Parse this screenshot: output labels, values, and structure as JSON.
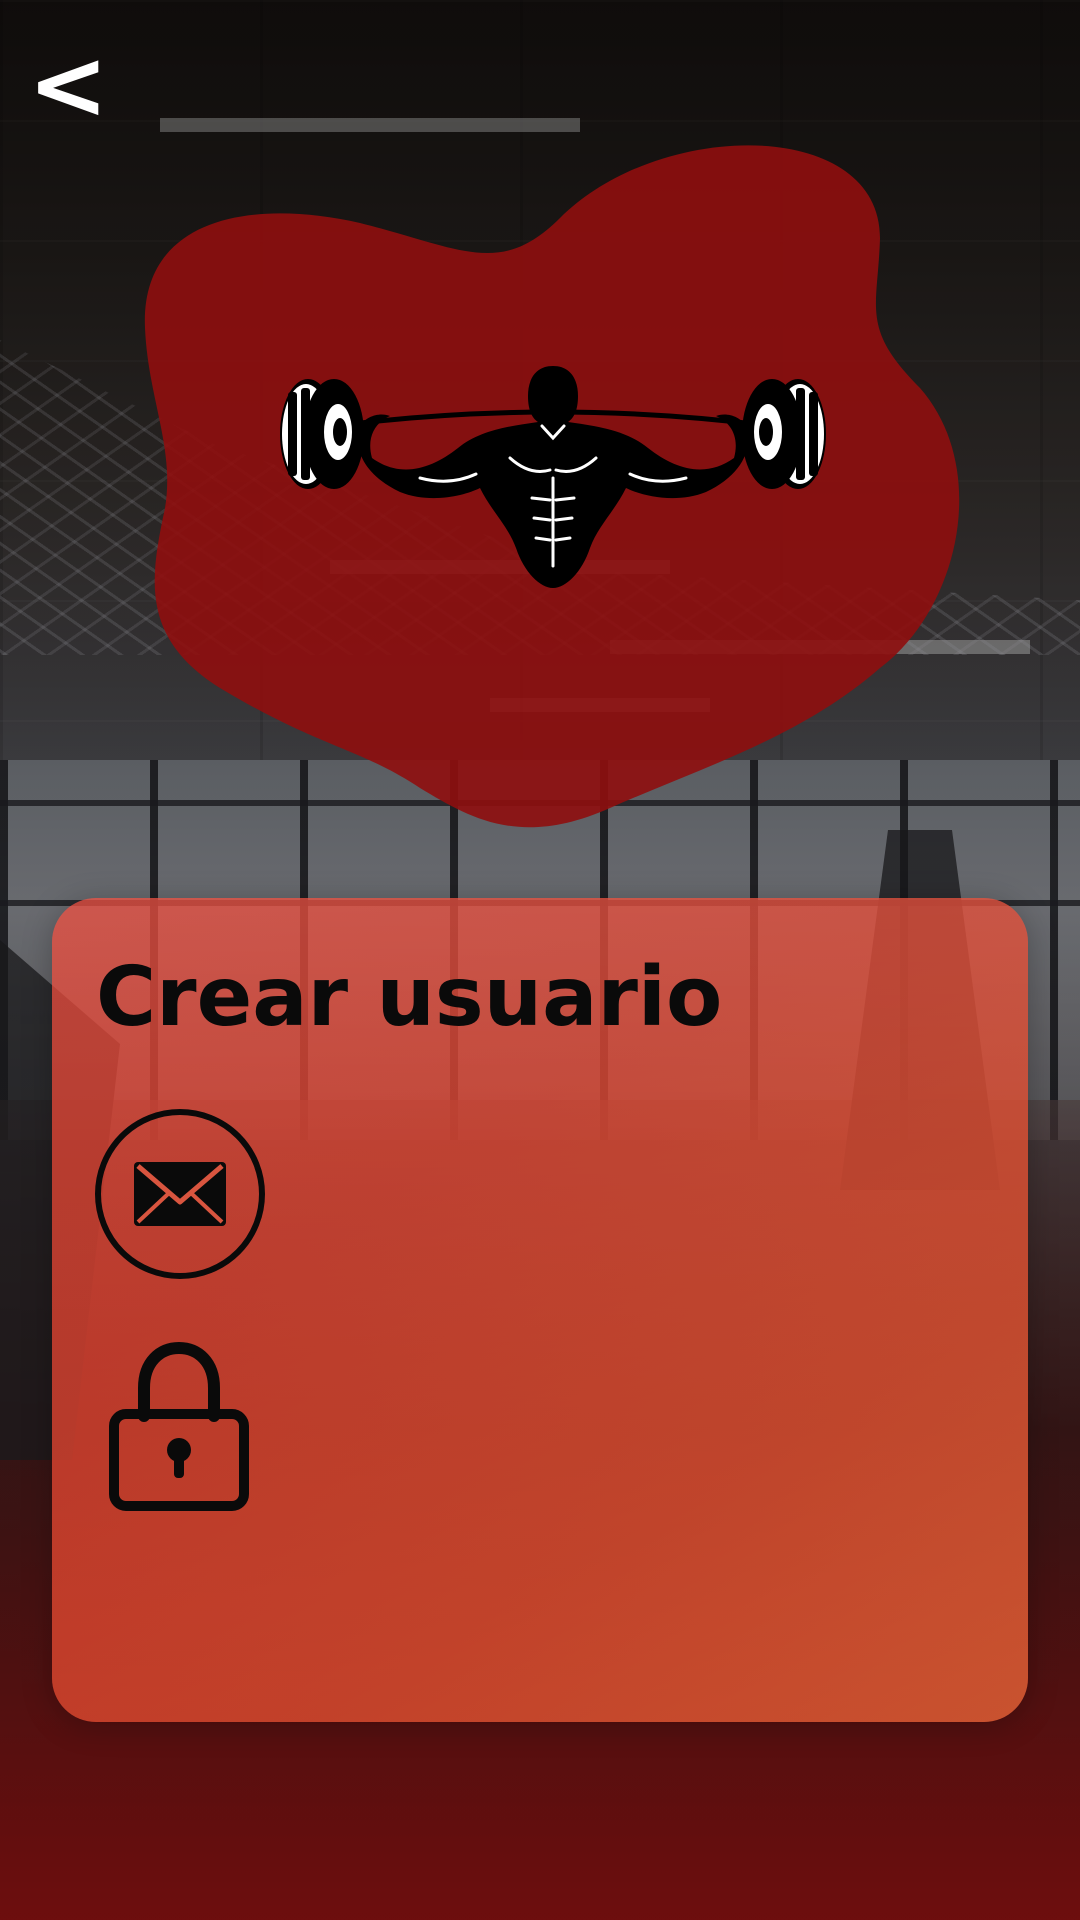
{
  "nav": {
    "back_label": "<"
  },
  "logo": {
    "icon": "bodybuilder-barbell-icon"
  },
  "card": {
    "title": "Crear usuario",
    "email": {
      "icon": "envelope-icon",
      "value": "",
      "placeholder": ""
    },
    "password": {
      "icon": "lock-icon",
      "value": "",
      "placeholder": ""
    }
  },
  "colors": {
    "blob": "#8f0e0e",
    "card_start": "#e8433a",
    "card_end": "#d9643d",
    "icon_stroke": "#0a0a0a",
    "back_text": "#ffffff"
  }
}
